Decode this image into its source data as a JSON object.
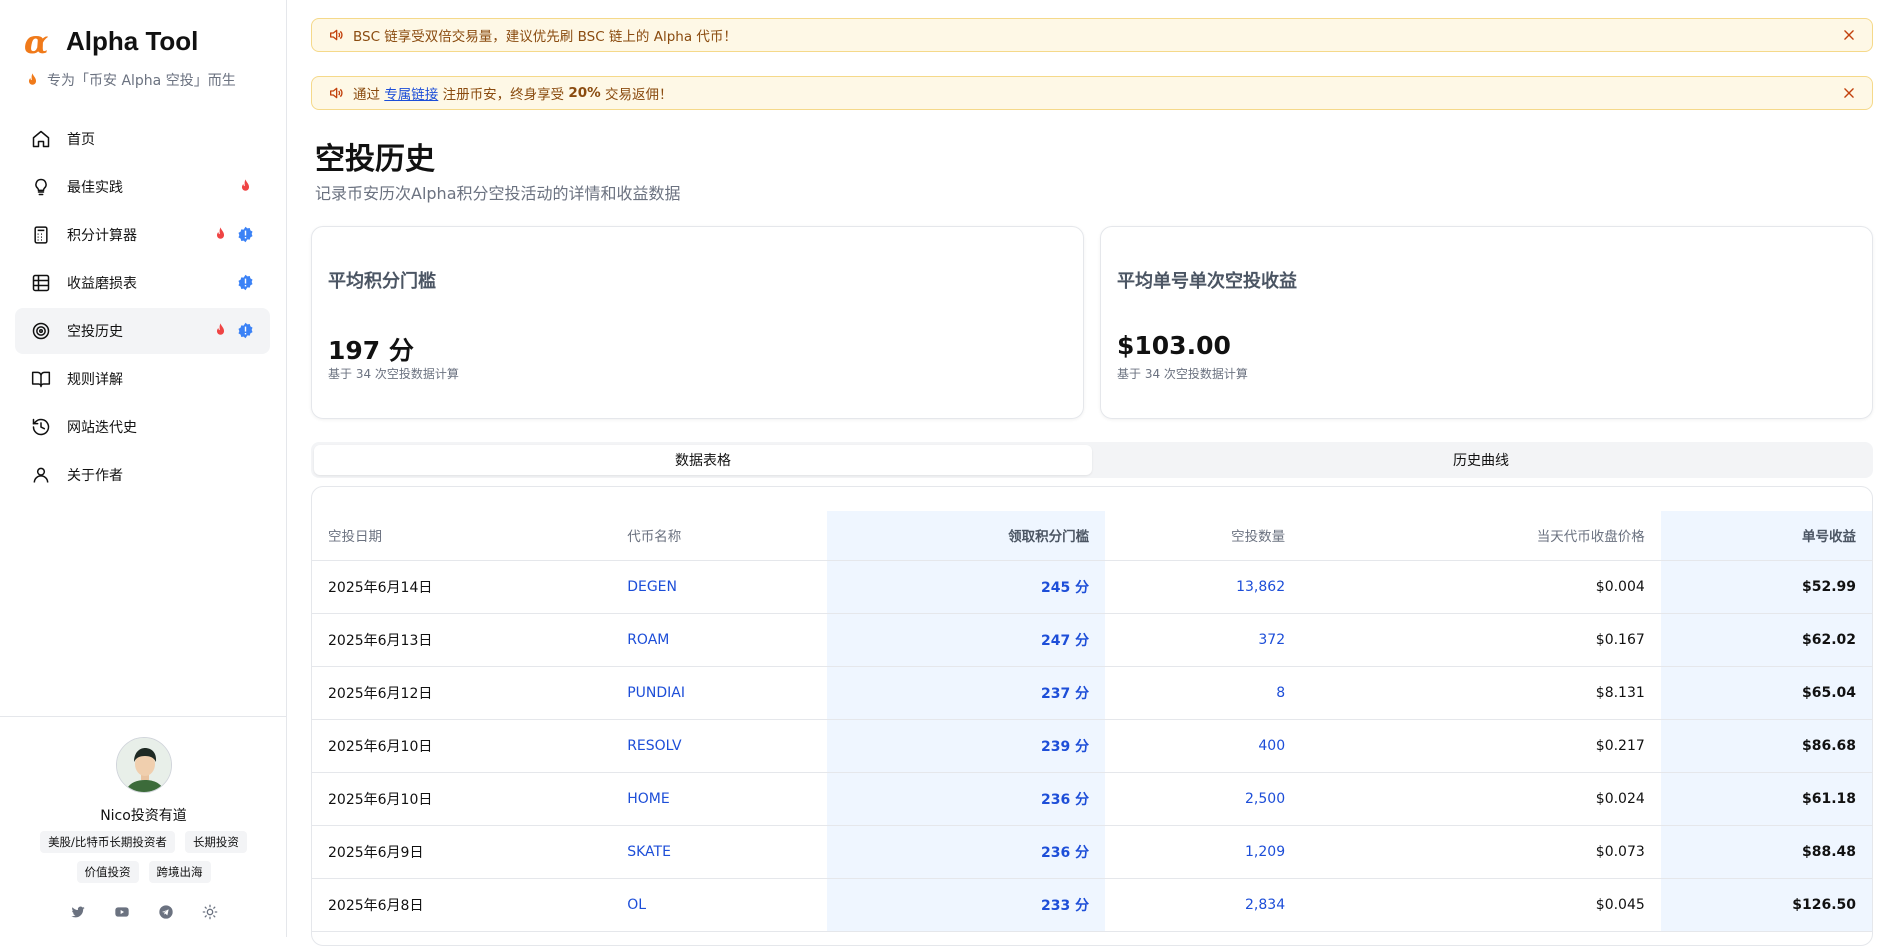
{
  "brand": {
    "name": "Alpha Tool",
    "logo": "α",
    "tagline": "专为「币安 Alpha 空投」而生"
  },
  "nav": [
    {
      "label": "首页",
      "icon": "home-icon",
      "fire": false,
      "badge": false
    },
    {
      "label": "最佳实践",
      "icon": "lightbulb-icon",
      "fire": true,
      "badge": false
    },
    {
      "label": "积分计算器",
      "icon": "calculator-icon",
      "fire": true,
      "badge": true
    },
    {
      "label": "收益磨损表",
      "icon": "table-icon",
      "fire": false,
      "badge": true
    },
    {
      "label": "空投历史",
      "icon": "target-icon",
      "fire": true,
      "badge": true,
      "active": true
    },
    {
      "label": "规则详解",
      "icon": "book-icon",
      "fire": false,
      "badge": false
    },
    {
      "label": "网站迭代史",
      "icon": "history-icon",
      "fire": false,
      "badge": false
    },
    {
      "label": "关于作者",
      "icon": "user-icon",
      "fire": false,
      "badge": false
    }
  ],
  "profile": {
    "name": "Nico投资有道",
    "tags": [
      "美股/比特币长期投资者",
      "长期投资",
      "价值投资",
      "跨境出海"
    ],
    "socials": [
      "twitter-icon",
      "youtube-icon",
      "telegram-icon",
      "theme-toggle-icon"
    ]
  },
  "notices": [
    {
      "text": "BSC 链享受双倍交易量，建议优先刷 BSC 链上的 Alpha 代币！"
    },
    {
      "prefix": "通过 ",
      "link": "专属链接",
      "middle": " 注册币安，终身享受 ",
      "bold": "20%",
      "suffix": " 交易返佣！"
    }
  ],
  "page": {
    "title": "空投历史",
    "subtitle": "记录币安历次Alpha积分空投活动的详情和收益数据"
  },
  "cards": [
    {
      "title": "平均积分门槛",
      "value": "197 分",
      "note": "基于 34 次空投数据计算"
    },
    {
      "title": "平均单号单次空投收益",
      "value": "$103.00",
      "note": "基于 34 次空投数据计算"
    }
  ],
  "tabs": [
    {
      "label": "数据表格",
      "active": true
    },
    {
      "label": "历史曲线",
      "active": false
    }
  ],
  "table": {
    "headers": [
      "空投日期",
      "代币名称",
      "领取积分门槛",
      "空投数量",
      "当天代币收盘价格",
      "单号收益"
    ],
    "rows": [
      [
        "2025年6月14日",
        "DEGEN",
        "245 分",
        "13,862",
        "$0.004",
        "$52.99"
      ],
      [
        "2025年6月13日",
        "ROAM",
        "247 分",
        "372",
        "$0.167",
        "$62.02"
      ],
      [
        "2025年6月12日",
        "PUNDIAI",
        "237 分",
        "8",
        "$8.131",
        "$65.04"
      ],
      [
        "2025年6月10日",
        "RESOLV",
        "239 分",
        "400",
        "$0.217",
        "$86.68"
      ],
      [
        "2025年6月10日",
        "HOME",
        "236 分",
        "2,500",
        "$0.024",
        "$61.18"
      ],
      [
        "2025年6月9日",
        "SKATE",
        "236 分",
        "1,209",
        "$0.073",
        "$88.48"
      ],
      [
        "2025年6月8日",
        "OL",
        "233 分",
        "2,834",
        "$0.045",
        "$126.50"
      ]
    ]
  },
  "colors": {
    "accent": "#f07a1a",
    "link": "#1d4ed8",
    "fire": "#ef4444",
    "badge": "#3b82f6",
    "notice_bg": "#fef8e6"
  }
}
